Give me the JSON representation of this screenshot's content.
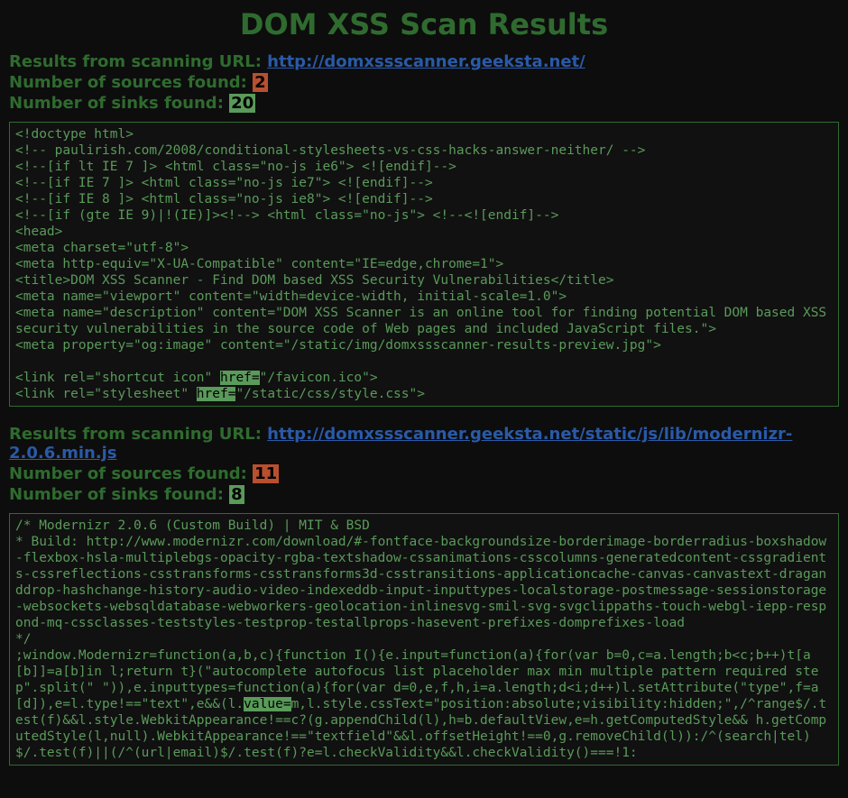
{
  "title": "DOM XSS Scan Results",
  "blocks": [
    {
      "url_label": "Results from scanning URL: ",
      "url": "http://domxssscanner.geeksta.net/",
      "sources_label": "Number of sources found: ",
      "sources": "2",
      "sinks_label": "Number of sinks found: ",
      "sinks": "20",
      "code": [
        {
          "t": "<!doctype html>\n<!-- paulirish.com/2008/conditional-stylesheets-vs-css-hacks-answer-neither/ -->\n<!--[if lt IE 7 ]> <html class=\"no-js ie6\"> <![endif]-->\n<!--[if IE 7 ]> <html class=\"no-js ie7\"> <![endif]-->\n<!--[if IE 8 ]> <html class=\"no-js ie8\"> <![endif]-->\n<!--[if (gte IE 9)|!(IE)]><!--> <html class=\"no-js\"> <!--<![endif]-->\n<head>\n<meta charset=\"utf-8\">\n<meta http-equiv=\"X-UA-Compatible\" content=\"IE=edge,chrome=1\">\n<title>DOM XSS Scanner - Find DOM based XSS Security Vulnerabilities</title>\n<meta name=\"viewport\" content=\"width=device-width, initial-scale=1.0\">\n<meta name=\"description\" content=\"DOM XSS Scanner is an online tool for finding potential DOM based XSS security vulnerabilities in the source code of Web pages and included JavaScript files.\">\n<meta property=\"og:image\" content=\"/static/img/domxssscanner-results-preview.jpg\">\n\n<link rel=\"shortcut icon\" "
        },
        {
          "t": "href=",
          "c": "sink"
        },
        {
          "t": "\"/favicon.ico\">\n<link rel=\"stylesheet\" "
        },
        {
          "t": "href=",
          "c": "sink"
        },
        {
          "t": "\"/static/css/style.css\">"
        }
      ]
    },
    {
      "url_label": "Results from scanning URL: ",
      "url": "http://domxssscanner.geeksta.net/static/js/lib/modernizr-2.0.6.min.js",
      "sources_label": "Number of sources found: ",
      "sources": "11",
      "sinks_label": "Number of sinks found: ",
      "sinks": "8",
      "code": [
        {
          "t": "/* Modernizr 2.0.6 (Custom Build) | MIT & BSD\n* Build: http://www.modernizr.com/download/#-fontface-backgroundsize-borderimage-borderradius-boxshadow-flexbox-hsla-multiplebgs-opacity-rgba-textshadow-cssanimations-csscolumns-generatedcontent-cssgradients-cssreflections-csstransforms-csstransforms3d-csstransitions-applicationcache-canvas-canvastext-draganddrop-hashchange-history-audio-video-indexeddb-input-inputtypes-localstorage-postmessage-sessionstorage-websockets-websqldatabase-webworkers-geolocation-inlinesvg-smil-svg-svgclippaths-touch-webgl-iepp-respond-mq-cssclasses-teststyles-testprop-testallprops-hasevent-prefixes-domprefixes-load\n*/\n;window.Modernizr=function(a,b,c){function I(){e.input=function(a){for(var b=0,c=a.length;b<c;b++)t[a[b]]=a[b]in l;return t}(\"autocomplete autofocus list placeholder max min multiple pattern required step\".split(\" \")),e.inputtypes=function(a){for(var d=0,e,f,h,i=a.length;d<i;d++)l.setAttribute(\"type\",f=a[d]),e=l.type!==\"text\",e&&(l."
        },
        {
          "t": "value=",
          "c": "sink"
        },
        {
          "t": "m,l.style.cssText=\"position:absolute;visibility:hidden;\",/^range$/.test(f)&&l.style.WebkitAppearance!==c?(g.appendChild(l),h=b.defaultView,e=h.getComputedStyle&& h.getComputedStyle(l,null).WebkitAppearance!==\"textfield\"&&l.offsetHeight!==0,g.removeChild(l)):/^(search|tel)$/.test(f)||(/^(url|email)$/.test(f)?e=l.checkValidity&&l.checkValidity()===!1:"
        }
      ]
    }
  ]
}
